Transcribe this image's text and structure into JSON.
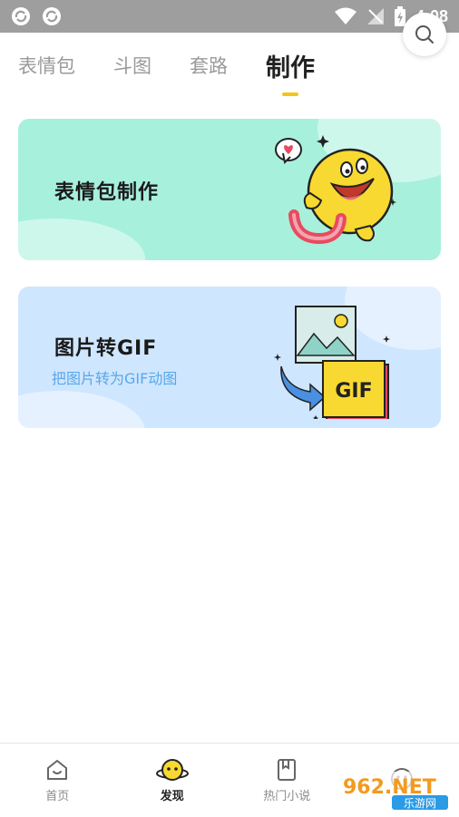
{
  "status_bar": {
    "time": "4:08",
    "icons": [
      "sync-icon",
      "sync-icon",
      "wifi-icon",
      "no-signal-icon",
      "battery-charging-icon"
    ]
  },
  "tabs": [
    {
      "label": "表情包",
      "active": false
    },
    {
      "label": "斗图",
      "active": false
    },
    {
      "label": "套路",
      "active": false
    },
    {
      "label": "制作",
      "active": true
    }
  ],
  "search": {
    "icon": "search-icon"
  },
  "cards": [
    {
      "title": "表情包制作",
      "color": "#a7f0dc"
    },
    {
      "title": "图片转GIF",
      "subtitle": "把图片转为GIF动图",
      "badge": "GIF",
      "color": "#cfe6ff"
    }
  ],
  "bottom_nav": [
    {
      "label": "首页",
      "icon": "home-icon",
      "active": false
    },
    {
      "label": "发现",
      "icon": "discover-icon",
      "active": true
    },
    {
      "label": "热门小说",
      "icon": "book-icon",
      "active": false
    },
    {
      "label": "",
      "icon": "face-icon",
      "active": false
    }
  ],
  "watermark": {
    "brand": "962.NET",
    "sub": "乐游网"
  },
  "colors": {
    "accent": "#f5c518",
    "status_bar": "#9e9e9e",
    "subtitle": "#59a8e8"
  }
}
